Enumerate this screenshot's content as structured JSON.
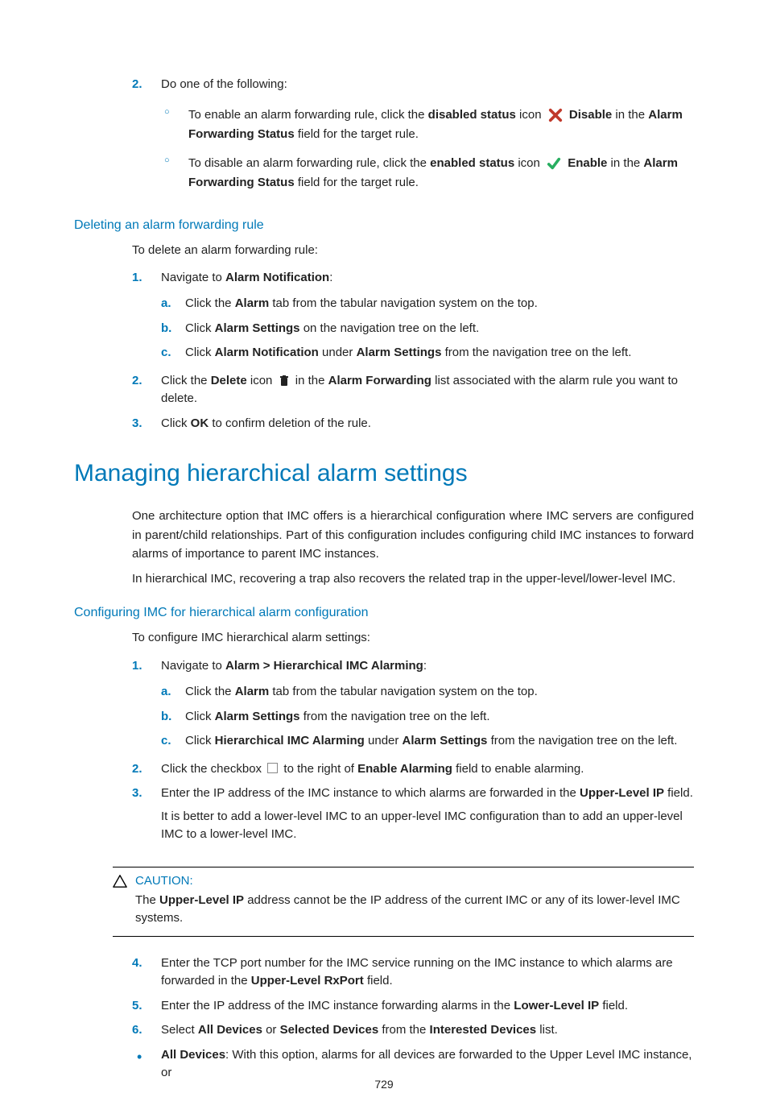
{
  "top": {
    "step2": {
      "mk": "2.",
      "text": "Do one of the following:"
    },
    "bullets": [
      {
        "pre": "To enable an alarm forwarding rule, click the ",
        "bold1": "disabled status",
        "mid": " icon ",
        "iconName": "disable-icon",
        "bold2": "Disable",
        "mid2": " in the ",
        "bold3": "Alarm Forwarding Status",
        "post": " field for the target rule."
      },
      {
        "pre": "To disable an alarm forwarding rule, click the ",
        "bold1": "enabled status",
        "mid": " icon ",
        "iconName": "enable-icon",
        "bold2": "Enable",
        "mid2": " in the ",
        "bold3": "Alarm Forwarding Status",
        "post": " field for the target rule."
      }
    ]
  },
  "secDelete": {
    "title": "Deleting an alarm forwarding rule",
    "intro": "To delete an alarm forwarding rule:",
    "s1": {
      "mk": "1.",
      "pre": "Navigate to ",
      "b": "Alarm Notification",
      "post": ":"
    },
    "s1a": {
      "mk": "a.",
      "pre": "Click the ",
      "b": "Alarm",
      "post": " tab from the tabular navigation system on the top."
    },
    "s1b": {
      "mk": "b.",
      "pre": "Click ",
      "b": "Alarm Settings",
      "post": " on the navigation tree on the left."
    },
    "s1c": {
      "mk": "c.",
      "pre": "Click ",
      "b1": "Alarm Notification",
      "mid": " under ",
      "b2": "Alarm Settings",
      "post": " from the navigation tree on the left."
    },
    "s2": {
      "mk": "2.",
      "pre": "Click the ",
      "b1": "Delete",
      "mid": " icon ",
      "iconName": "delete-icon",
      "mid2": " in the ",
      "b2": "Alarm Forwarding",
      "post": " list associated with the alarm rule you want to delete."
    },
    "s3": {
      "mk": "3.",
      "pre": "Click ",
      "b": "OK",
      "post": " to confirm deletion of the rule."
    }
  },
  "hier": {
    "title": "Managing hierarchical alarm settings",
    "p1": "One architecture option that IMC offers is a hierarchical configuration where IMC servers are configured in parent/child relationships. Part of this configuration includes configuring child IMC instances to forward alarms of importance to parent IMC instances.",
    "p2": "In hierarchical IMC, recovering a trap also recovers the related trap in the upper-level/lower-level IMC."
  },
  "conf": {
    "title": "Configuring IMC for hierarchical alarm configuration",
    "intro": "To configure IMC hierarchical alarm settings:",
    "s1": {
      "mk": "1.",
      "pre": "Navigate to ",
      "b": "Alarm > Hierarchical IMC Alarming",
      "post": ":"
    },
    "s1a": {
      "mk": "a.",
      "pre": "Click the ",
      "b": "Alarm",
      "post": " tab from the tabular navigation system on the top."
    },
    "s1b": {
      "mk": "b.",
      "pre": "Click ",
      "b": "Alarm Settings",
      "post": " from the navigation tree on the left."
    },
    "s1c": {
      "mk": "c.",
      "pre": "Click ",
      "b1": "Hierarchical IMC Alarming",
      "mid": " under ",
      "b2": "Alarm Settings",
      "post": " from the navigation tree on the left."
    },
    "s2": {
      "mk": "2.",
      "pre": "Click the checkbox ",
      "mid": " to the right of ",
      "b": "Enable Alarming",
      "post": " field to enable alarming."
    },
    "s3": {
      "mk": "3.",
      "pre": "Enter the IP address of the IMC instance to which alarms are forwarded in the ",
      "b": "Upper-Level IP",
      "post": " field."
    },
    "s3note": "It is better to add a lower-level IMC to an upper-level IMC configuration than to add an upper-level IMC to a lower-level IMC.",
    "caution": {
      "label": "CAUTION:",
      "pre": "The ",
      "b": "Upper-Level IP",
      "post": " address cannot be the IP address of the current IMC or any of its lower-level IMC systems."
    },
    "s4": {
      "mk": "4.",
      "pre": "Enter the TCP port number for the IMC service running on the IMC instance to which alarms are forwarded in the ",
      "b": "Upper-Level RxPort",
      "post": " field."
    },
    "s5": {
      "mk": "5.",
      "pre": "Enter the IP address of the IMC instance forwarding alarms in the ",
      "b": "Lower-Level IP",
      "post": " field."
    },
    "s6": {
      "mk": "6.",
      "pre": "Select ",
      "b1": "All Devices",
      "mid": " or ",
      "b2": "Selected Devices",
      "mid2": " from the ",
      "b3": "Interested Devices",
      "post": " list."
    },
    "bul": {
      "b": "All Devices",
      "post": ": With this option, alarms for all devices are forwarded to the Upper Level IMC instance, or"
    }
  },
  "pageNumber": "729"
}
